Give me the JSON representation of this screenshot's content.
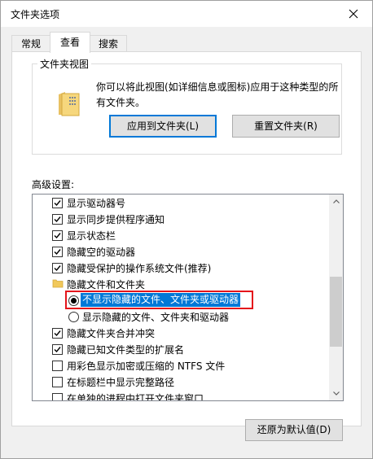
{
  "window": {
    "title": "文件夹选项"
  },
  "tabs": [
    {
      "label": "常规"
    },
    {
      "label": "查看"
    },
    {
      "label": "搜索"
    }
  ],
  "folder_views": {
    "group_label": "文件夹视图",
    "description": "你可以将此视图(如详细信息或图标)应用于这种类型的所有文件夹。",
    "apply_button": "应用到文件夹(L)",
    "reset_button": "重置文件夹(R)"
  },
  "advanced": {
    "label": "高级设置:",
    "items": [
      {
        "type": "checkbox",
        "label": "显示驱动器号",
        "checked": true
      },
      {
        "type": "checkbox",
        "label": "显示同步提供程序通知",
        "checked": true
      },
      {
        "type": "checkbox",
        "label": "显示状态栏",
        "checked": true
      },
      {
        "type": "checkbox",
        "label": "隐藏空的驱动器",
        "checked": true
      },
      {
        "type": "checkbox",
        "label": "隐藏受保护的操作系统文件(推荐)",
        "checked": true
      },
      {
        "type": "folder",
        "label": "隐藏文件和文件夹"
      },
      {
        "type": "radio",
        "label": "不显示隐藏的文件、文件夹或驱动器",
        "selected": true
      },
      {
        "type": "radio",
        "label": "显示隐藏的文件、文件夹和驱动器",
        "selected": false
      },
      {
        "type": "checkbox",
        "label": "隐藏文件夹合并冲突",
        "checked": true
      },
      {
        "type": "checkbox",
        "label": "隐藏已知文件类型的扩展名",
        "checked": true
      },
      {
        "type": "checkbox",
        "label": "用彩色显示加密或压缩的 NTFS 文件",
        "checked": false
      },
      {
        "type": "checkbox",
        "label": "在标题栏中显示完整路径",
        "checked": false
      },
      {
        "type": "checkbox",
        "label": "在单独的进程中打开文件夹窗口",
        "checked": false
      }
    ]
  },
  "restore_button": "还原为默认值(D)",
  "colors": {
    "accent": "#0078d7",
    "annotation": "#e4151b",
    "dialog_bg": "#f0f0f0"
  }
}
